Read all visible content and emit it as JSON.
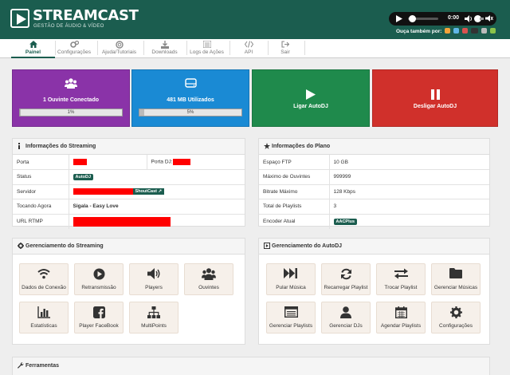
{
  "header": {
    "logo_title": "STREAMCAST",
    "logo_subtitle": "GESTÃO DE ÁUDIO & VÍDEO",
    "player_time": "0:00",
    "ouca_label": "Ouça também por:"
  },
  "nav": [
    {
      "label": "Painel",
      "icon": "home-icon"
    },
    {
      "label": "Configurações",
      "icon": "gears-icon"
    },
    {
      "label": "Ajuda/Tutoriais",
      "icon": "lifebuoy-icon"
    },
    {
      "label": "Downloads",
      "icon": "download-icon"
    },
    {
      "label": "Logs de Ações",
      "icon": "list-icon"
    },
    {
      "label": "API",
      "icon": "code-icon"
    },
    {
      "label": "Sair",
      "icon": "exit-icon"
    }
  ],
  "stats": [
    {
      "label": "1 Ouvinte Conectado",
      "progress_label": "1%",
      "progress": 0.01,
      "color": "#8a33a8"
    },
    {
      "label": "481 MB Utilizados",
      "progress_label": "5%",
      "progress": 0.05,
      "color": "#1a8ad4"
    },
    {
      "label": "Ligar AutoDJ",
      "color": "#1f8a4c"
    },
    {
      "label": "Desligar AutoDJ",
      "color": "#d0302b"
    }
  ],
  "streaming_info": {
    "title": "Informações do Streaming",
    "porta_label": "Porta",
    "porta_dj_label": "Porta DJ:",
    "status_label": "Status",
    "status_value": "AutoDJ",
    "servidor_label": "Servidor",
    "servidor_badge": "ShoutCast",
    "tocando_label": "Tocando Agora",
    "tocando_value": "Sigala - Easy Love",
    "rtmp_label": "URL RTMP"
  },
  "plan_info": {
    "title": "Informações do Plano",
    "rows": [
      {
        "label": "Espaço FTP",
        "value": "10 GB"
      },
      {
        "label": "Máximo de Ouvintes",
        "value": "999999"
      },
      {
        "label": "Bitrate Máximo",
        "value": "128 Kbps"
      },
      {
        "label": "Total de Playlists",
        "value": "3"
      },
      {
        "label": "Encoder Atual",
        "value": "AACPlus"
      }
    ]
  },
  "streaming_mgmt": {
    "title": "Gerenciamento do Streaming",
    "tiles": [
      "Dados de Conexão",
      "Retransmissão",
      "Players",
      "Ouvintes",
      "Estatísticas",
      "Player FaceBook",
      "MultiPoints"
    ]
  },
  "autodj_mgmt": {
    "title": "Gerenciamento do AutoDJ",
    "tiles": [
      "Pular Música",
      "Recarregar Playlist",
      "Trocar Playlist",
      "Gerenciar Músicas",
      "Gerenciar Playlists",
      "Gerenciar DJs",
      "Agendar Playlists",
      "Configurações"
    ]
  },
  "tools": {
    "title": "Ferramentas"
  }
}
